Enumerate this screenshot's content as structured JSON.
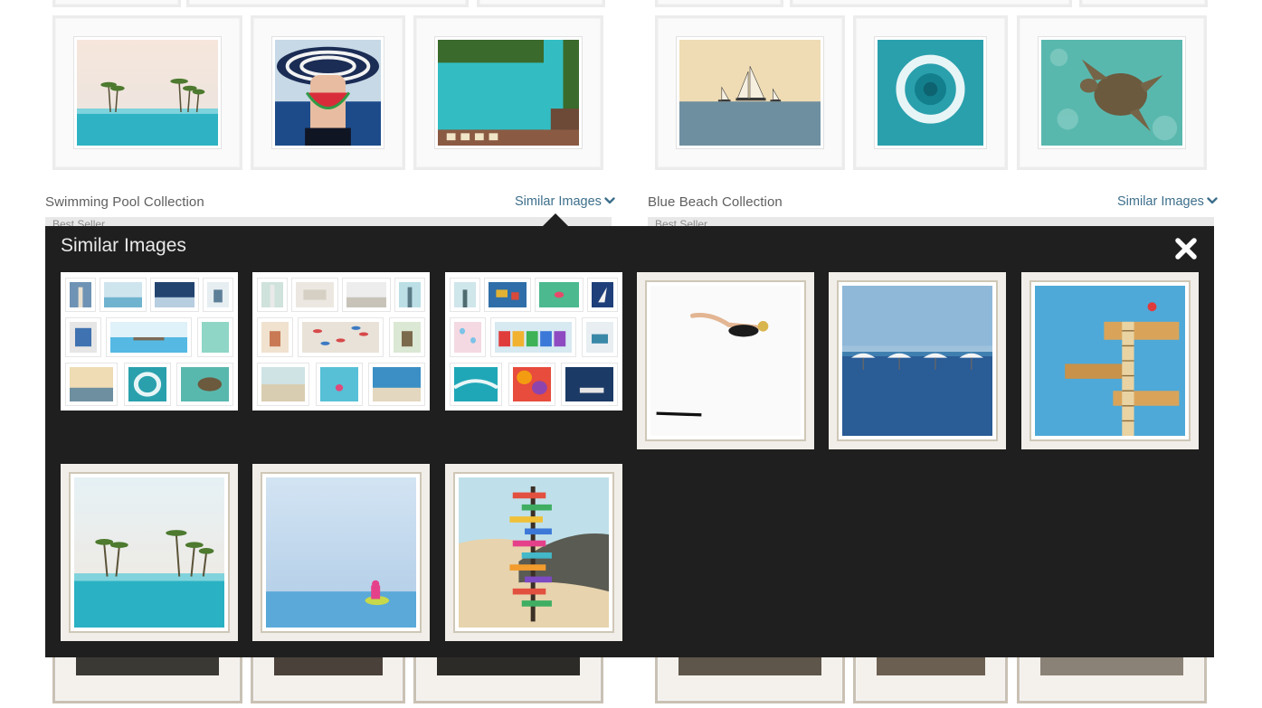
{
  "collections": [
    {
      "title": "Swimming Pool Collection",
      "similar_label": "Similar Images",
      "seller": "Best Seller"
    },
    {
      "title": "Blue Beach Collection",
      "similar_label": "Similar Images",
      "seller": "Best Seller"
    }
  ],
  "popup": {
    "title": "Similar Images",
    "close_icon": "close-icon"
  },
  "colors": {
    "link": "#3e6f8c",
    "popup_bg": "#1f1f1f",
    "title_text": "#5f5f5f"
  }
}
